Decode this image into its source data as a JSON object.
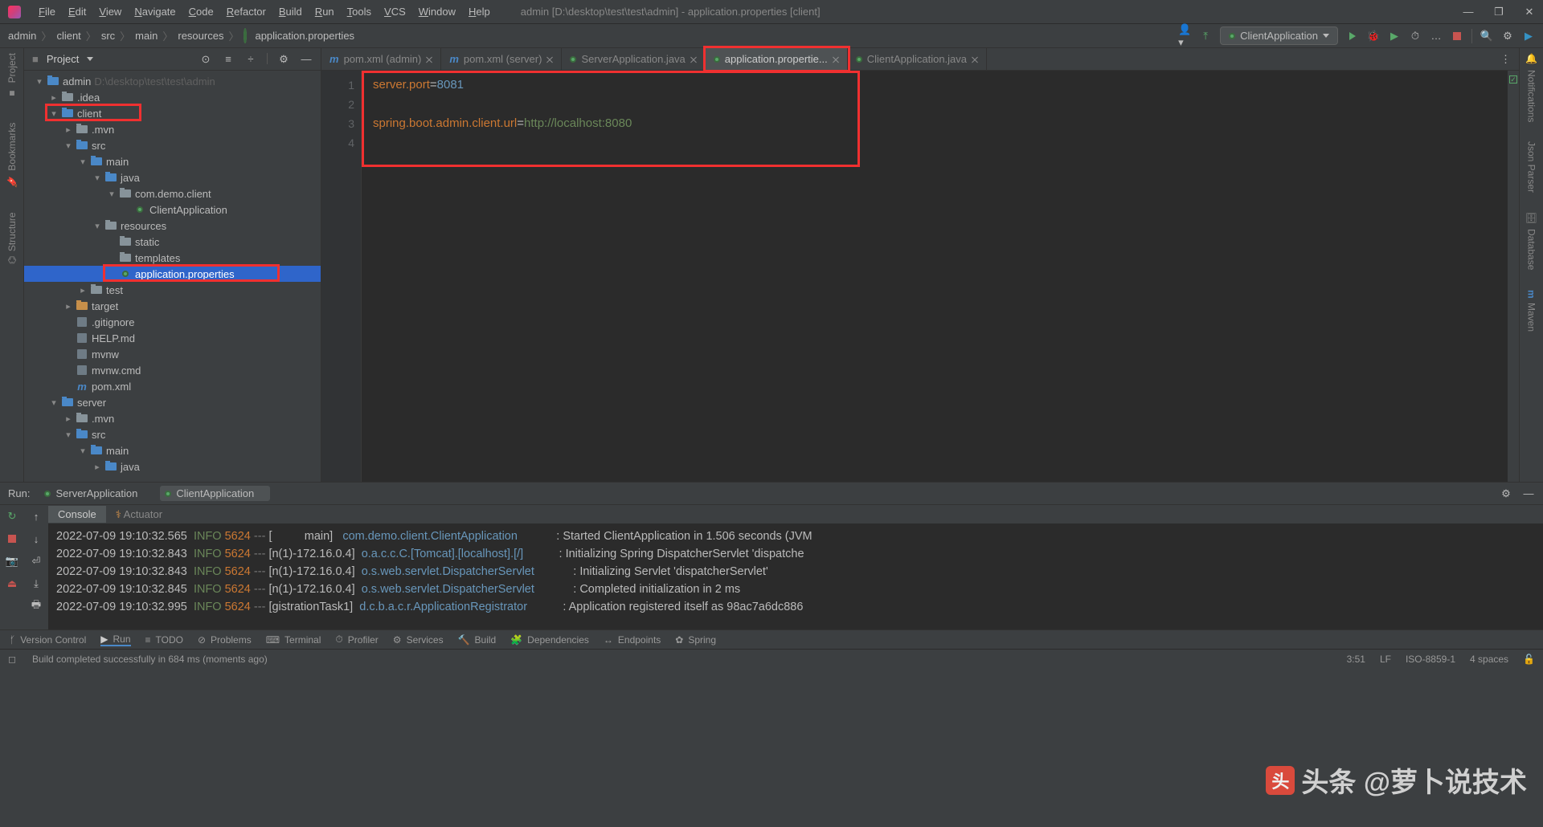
{
  "titlebar": {
    "menus": [
      "File",
      "Edit",
      "View",
      "Navigate",
      "Code",
      "Refactor",
      "Build",
      "Run",
      "Tools",
      "VCS",
      "Window",
      "Help"
    ],
    "title": "admin [D:\\desktop\\test\\test\\admin] - application.properties [client]"
  },
  "breadcrumbs": [
    "admin",
    "client",
    "src",
    "main",
    "resources",
    "application.properties"
  ],
  "runConfig": "ClientApplication",
  "project": {
    "header": "Project",
    "tree": [
      {
        "d": 0,
        "chev": "▾",
        "icon": "folder-blue",
        "label": "admin",
        "hint": " D:\\desktop\\test\\test\\admin"
      },
      {
        "d": 1,
        "chev": "▸",
        "icon": "folder",
        "label": ".idea"
      },
      {
        "d": 1,
        "chev": "▾",
        "icon": "folder-blue",
        "label": "client",
        "boxed": true
      },
      {
        "d": 2,
        "chev": "▸",
        "icon": "folder",
        "label": ".mvn"
      },
      {
        "d": 2,
        "chev": "▾",
        "icon": "folder-blue",
        "label": "src"
      },
      {
        "d": 3,
        "chev": "▾",
        "icon": "folder-blue",
        "label": "main"
      },
      {
        "d": 4,
        "chev": "▾",
        "icon": "folder-blue",
        "label": "java"
      },
      {
        "d": 5,
        "chev": "▾",
        "icon": "folder",
        "label": "com.demo.client"
      },
      {
        "d": 6,
        "chev": "",
        "icon": "class",
        "label": "ClientApplication"
      },
      {
        "d": 4,
        "chev": "▾",
        "icon": "folder",
        "label": "resources"
      },
      {
        "d": 5,
        "chev": "",
        "icon": "folder",
        "label": "static"
      },
      {
        "d": 5,
        "chev": "",
        "icon": "folder",
        "label": "templates"
      },
      {
        "d": 5,
        "chev": "",
        "icon": "props",
        "label": "application.properties",
        "sel": true,
        "boxed": true
      },
      {
        "d": 3,
        "chev": "▸",
        "icon": "folder",
        "label": "test"
      },
      {
        "d": 2,
        "chev": "▸",
        "icon": "folder-orange",
        "label": "target"
      },
      {
        "d": 2,
        "chev": "",
        "icon": "file",
        "label": ".gitignore"
      },
      {
        "d": 2,
        "chev": "",
        "icon": "file",
        "label": "HELP.md"
      },
      {
        "d": 2,
        "chev": "",
        "icon": "file",
        "label": "mvnw"
      },
      {
        "d": 2,
        "chev": "",
        "icon": "file",
        "label": "mvnw.cmd"
      },
      {
        "d": 2,
        "chev": "",
        "icon": "maven",
        "label": "pom.xml"
      },
      {
        "d": 1,
        "chev": "▾",
        "icon": "folder-blue",
        "label": "server"
      },
      {
        "d": 2,
        "chev": "▸",
        "icon": "folder",
        "label": ".mvn"
      },
      {
        "d": 2,
        "chev": "▾",
        "icon": "folder-blue",
        "label": "src"
      },
      {
        "d": 3,
        "chev": "▾",
        "icon": "folder-blue",
        "label": "main"
      },
      {
        "d": 4,
        "chev": "▸",
        "icon": "folder-blue",
        "label": "java"
      }
    ]
  },
  "editorTabs": [
    {
      "label": "pom.xml (admin)",
      "icon": "maven"
    },
    {
      "label": "pom.xml (server)",
      "icon": "maven"
    },
    {
      "label": "ServerApplication.java",
      "icon": "class"
    },
    {
      "label": "application.propertie...",
      "icon": "props",
      "active": true,
      "boxed": true
    },
    {
      "label": "ClientApplication.java",
      "icon": "class"
    }
  ],
  "code": {
    "lines": [
      "1",
      "2",
      "3",
      "4"
    ],
    "l1_k": "server.port",
    "l1_eq": "=",
    "l1_v": "8081",
    "l3_k": "spring.boot.admin.client.url",
    "l3_eq": "=",
    "l3_v": "http://localhost:8080"
  },
  "leftTools": [
    "Project",
    "Bookmarks",
    "Structure"
  ],
  "rightTools": [
    "Notifications",
    "Json Parser",
    "Database",
    "Maven"
  ],
  "run": {
    "label": "Run:",
    "tabs": [
      {
        "label": "ServerApplication"
      },
      {
        "label": "ClientApplication",
        "active": true
      }
    ],
    "subtabs": [
      {
        "label": "Console",
        "active": true
      },
      {
        "label": "Actuator"
      }
    ],
    "log": [
      {
        "ts": "2022-07-09 19:10:32.565",
        "lvl": "INFO",
        "pid": "5624",
        "thread": "[          main]",
        "src": "com.demo.client.ClientApplication",
        "msg": "Started ClientApplication in 1.506 seconds (JVM"
      },
      {
        "ts": "2022-07-09 19:10:32.843",
        "lvl": "INFO",
        "pid": "5624",
        "thread": "[n(1)-172.16.0.4]",
        "src": "o.a.c.c.C.[Tomcat].[localhost].[/]",
        "msg": "Initializing Spring DispatcherServlet 'dispatche"
      },
      {
        "ts": "2022-07-09 19:10:32.843",
        "lvl": "INFO",
        "pid": "5624",
        "thread": "[n(1)-172.16.0.4]",
        "src": "o.s.web.servlet.DispatcherServlet",
        "msg": "Initializing Servlet 'dispatcherServlet'"
      },
      {
        "ts": "2022-07-09 19:10:32.845",
        "lvl": "INFO",
        "pid": "5624",
        "thread": "[n(1)-172.16.0.4]",
        "src": "o.s.web.servlet.DispatcherServlet",
        "msg": "Completed initialization in 2 ms"
      },
      {
        "ts": "2022-07-09 19:10:32.995",
        "lvl": "INFO",
        "pid": "5624",
        "thread": "[gistrationTask1]",
        "src": "d.c.b.a.c.r.ApplicationRegistrator",
        "msg": "Application registered itself as 98ac7a6dc886"
      }
    ]
  },
  "bottomTools": [
    "Version Control",
    "Run",
    "TODO",
    "Problems",
    "Terminal",
    "Profiler",
    "Services",
    "Build",
    "Dependencies",
    "Endpoints",
    "Spring"
  ],
  "status": {
    "msg": "Build completed successfully in 684 ms (moments ago)",
    "caret": "3:51",
    "lf": "LF",
    "enc": "ISO-8859-1",
    "indent": "4 spaces"
  },
  "watermark": "头条 @萝卜说技术"
}
